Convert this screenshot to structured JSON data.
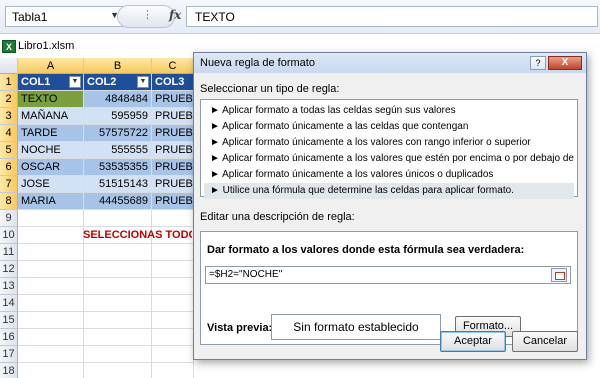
{
  "formula_bar": {
    "name_box": "Tabla1",
    "fx": "fx",
    "content": "TEXTO"
  },
  "workbook": {
    "name": "Libro1.xlsm",
    "icon": "excel-icon"
  },
  "columns": [
    "A",
    "B",
    "C"
  ],
  "rows": [
    "1",
    "2",
    "3",
    "4",
    "5",
    "6",
    "7",
    "8",
    "9",
    "10",
    "11",
    "12",
    "13",
    "14",
    "15",
    "16",
    "17",
    "18"
  ],
  "table": {
    "headers": [
      "COL1",
      "COL2",
      "COL3"
    ],
    "data": [
      [
        "TEXTO",
        "4848484",
        "PRUEBA"
      ],
      [
        "MAÑANA",
        "595959",
        "PRUEBA"
      ],
      [
        "TARDE",
        "57575722",
        "PRUEBA"
      ],
      [
        "NOCHE",
        "555555",
        "PRUEBA"
      ],
      [
        "OSCAR",
        "53535355",
        "PRUEBA"
      ],
      [
        "JOSE",
        "51515143",
        "PRUEBA"
      ],
      [
        "MARIA",
        "44455689",
        "PRUEBA"
      ]
    ]
  },
  "note": "SELECCIONAS TODO",
  "dialog": {
    "title": "Nueva regla de formato",
    "help": "?",
    "close": "X",
    "select_type_label": "Seleccionar un tipo de regla:",
    "rule_types": [
      "► Aplicar formato a todas las celdas según sus valores",
      "► Aplicar formato únicamente a las celdas que contengan",
      "► Aplicar formato únicamente a los valores con rango inferior o superior",
      "► Aplicar formato únicamente a los valores que estén por encima o por debajo del promedio",
      "► Aplicar formato únicamente a los valores únicos o duplicados",
      "► Utilice una fórmula que determine las celdas para aplicar formato."
    ],
    "edit_label": "Editar una descripción de regla:",
    "formula_label": "Dar formato a los valores donde esta fórmula sea verdadera:",
    "formula_value": "=$H2=\"NOCHE\"",
    "preview_label": "Vista previa:",
    "preview_text": "Sin formato establecido",
    "format_button": "Formato...",
    "ok_button": "Aceptar",
    "cancel_button": "Cancelar"
  },
  "colors": {
    "header_blue": "#1f4e9a",
    "band_dark": "#a8c3e8",
    "band_light": "#d3e1f4",
    "highlight_green": "#7d9e3f",
    "note_red": "#c00000"
  }
}
